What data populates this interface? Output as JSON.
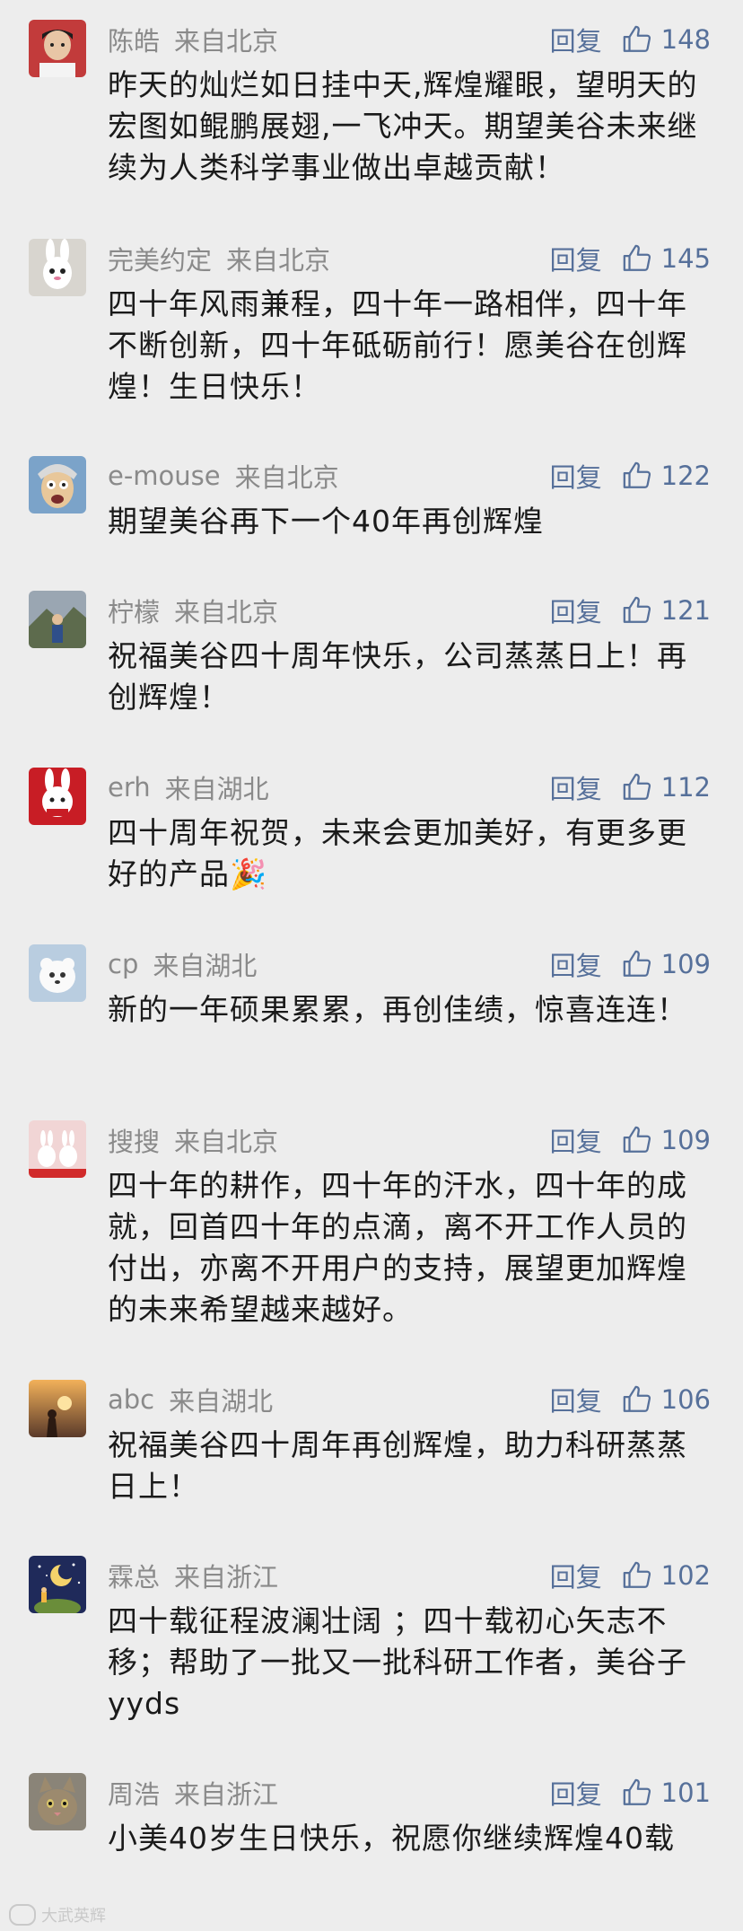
{
  "ui": {
    "reply_label": "回复",
    "watermark": "大武英辉"
  },
  "colors": {
    "background": "#ededed",
    "meta_text": "#8a8a8a",
    "link_blue": "#56709a",
    "body_text": "#1a1a1a"
  },
  "comments": [
    {
      "name": "陈皓",
      "location": "来自北京",
      "likes": "148",
      "text": "昨天的灿烂如日挂中天,辉煌耀眼，望明天的宏图如鲲鹏展翅,一飞冲天。期望美谷未来继续为人类科学事业做出卓越贡献！"
    },
    {
      "name": "完美约定",
      "location": "来自北京",
      "likes": "145",
      "text": "四十年风雨兼程，四十年一路相伴，四十年不断创新，四十年砥砺前行！愿美谷在创辉煌！生日快乐！"
    },
    {
      "name": "e-mouse",
      "location": "来自北京",
      "likes": "122",
      "text": "期望美谷再下一个40年再创辉煌"
    },
    {
      "name": "柠檬",
      "location": "来自北京",
      "likes": "121",
      "text": "祝福美谷四十周年快乐，公司蒸蒸日上！再创辉煌！"
    },
    {
      "name": "erh",
      "location": "来自湖北",
      "likes": "112",
      "text": "四十周年祝贺，未来会更加美好，有更多更好的产品🎉"
    },
    {
      "name": "cp",
      "location": "来自湖北",
      "likes": "109",
      "text": "新的一年硕果累累，再创佳绩，惊喜连连！"
    },
    {
      "name": "搜搜",
      "location": "来自北京",
      "likes": "109",
      "text": "四十年的耕作，四十年的汗水，四十年的成就，回首四十年的点滴，离不开工作人员的付出，亦离不开用户的支持，展望更加辉煌的未来希望越来越好。"
    },
    {
      "name": "abc",
      "location": "来自湖北",
      "likes": "106",
      "text": "祝福美谷四十周年再创辉煌，助力科研蒸蒸日上！"
    },
    {
      "name": "霖总",
      "location": "来自浙江",
      "likes": "102",
      "text": "四十载征程波澜壮阔 ；四十载初心矢志不移；帮助了一批又一批科研工作者，美谷子yyds"
    },
    {
      "name": "周浩",
      "location": "来自浙江",
      "likes": "101",
      "text": "小美40岁生日快乐，祝愿你继续辉煌40载"
    }
  ]
}
